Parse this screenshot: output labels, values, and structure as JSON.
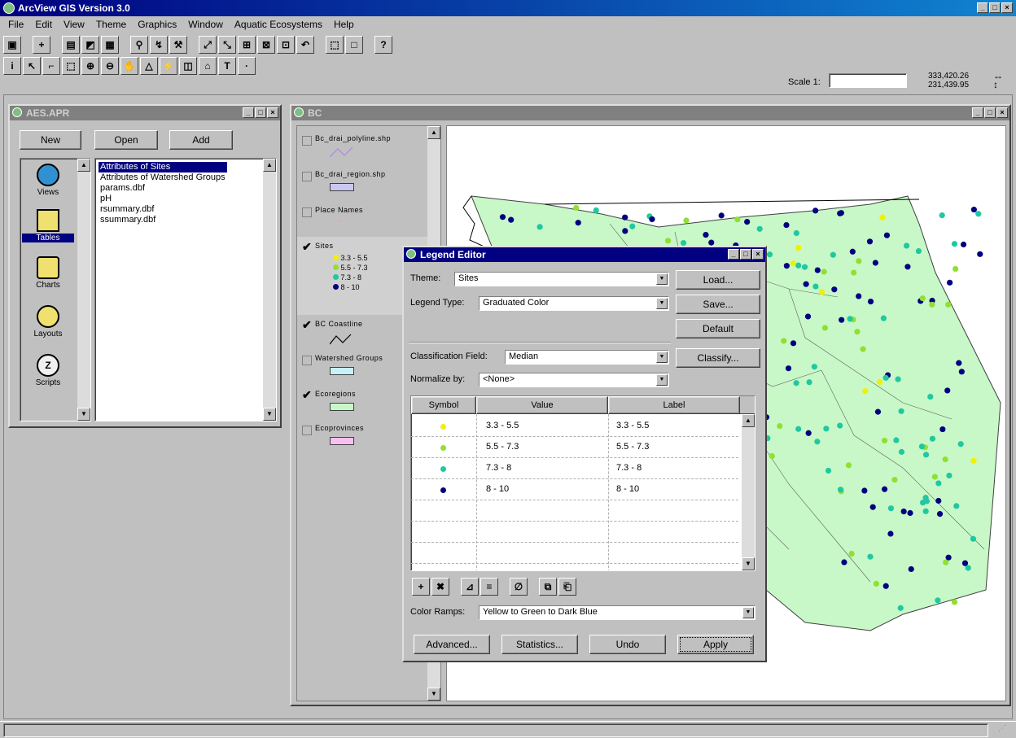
{
  "app": {
    "title": "ArcView GIS Version 3.0"
  },
  "menu": [
    "File",
    "Edit",
    "View",
    "Theme",
    "Graphics",
    "Window",
    "Aquatic Ecosystems",
    "Help"
  ],
  "toolbar": {
    "scale_label": "Scale 1:",
    "scale_value": "",
    "coord_x": "333,420.26",
    "coord_y": "231,439.95"
  },
  "project": {
    "title": "AES.APR",
    "new_label": "New",
    "open_label": "Open",
    "add_label": "Add",
    "doc_types": [
      "Views",
      "Tables",
      "Charts",
      "Layouts",
      "Scripts"
    ],
    "selected_type": "Tables",
    "items": [
      "Attributes of Sites",
      "Attributes of Watershed Groups",
      "params.dbf",
      "pH",
      "rsummary.dbf",
      "ssummary.dbf"
    ]
  },
  "view": {
    "title": "BC",
    "themes": [
      {
        "name": "Bc_drai_polyline.shp",
        "checked": false,
        "swatch": "line",
        "color": "#c0a0e0"
      },
      {
        "name": "Bc_drai_region.shp",
        "checked": false,
        "swatch": "fill",
        "color": "#c8c8f0"
      },
      {
        "name": "Place Names",
        "checked": false,
        "swatch": "point",
        "color": "#f0a0a0"
      },
      {
        "name": "Sites",
        "checked": true,
        "swatch": "classes"
      },
      {
        "name": "BC Coastline",
        "checked": true,
        "swatch": "line",
        "color": "#000000"
      },
      {
        "name": "Watershed Groups",
        "checked": false,
        "swatch": "fill",
        "color": "#c8f0f8"
      },
      {
        "name": "Ecoregions",
        "checked": true,
        "swatch": "fill",
        "color": "#c8f8c8"
      },
      {
        "name": "Ecoprovinces",
        "checked": false,
        "swatch": "fill",
        "color": "#f8c0f0"
      }
    ],
    "site_classes": [
      {
        "label": "3.3 - 5.5",
        "color": "#f0f000"
      },
      {
        "label": "5.5 - 7.3",
        "color": "#90e030"
      },
      {
        "label": "7.3 - 8",
        "color": "#20c8a0"
      },
      {
        "label": "8 - 10",
        "color": "#000080"
      }
    ]
  },
  "legend_editor": {
    "title": "Legend Editor",
    "theme_label": "Theme:",
    "theme_value": "Sites",
    "legend_type_label": "Legend Type:",
    "legend_type_value": "Graduated Color",
    "load_label": "Load...",
    "save_label": "Save...",
    "default_label": "Default",
    "classification_label": "Classification Field:",
    "classification_value": "Median",
    "classify_label": "Classify...",
    "normalize_label": "Normalize by:",
    "normalize_value": "<None>",
    "columns": [
      "Symbol",
      "Value",
      "Label"
    ],
    "rows": [
      {
        "value": "3.3 - 5.5",
        "label": "3.3 - 5.5",
        "color": "#f0f000"
      },
      {
        "value": "5.5 - 7.3",
        "label": "5.5 - 7.3",
        "color": "#90e030"
      },
      {
        "value": "7.3 - 8",
        "label": "7.3 - 8",
        "color": "#20c8a0"
      },
      {
        "value": "8 - 10",
        "label": "8 - 10",
        "color": "#000080"
      }
    ],
    "color_ramps_label": "Color Ramps:",
    "color_ramps_value": "Yellow to Green to Dark Blue",
    "advanced_label": "Advanced...",
    "statistics_label": "Statistics...",
    "undo_label": "Undo",
    "apply_label": "Apply"
  },
  "colors": {
    "map_fill": "#c8f8c8",
    "title_active": "#000080",
    "title_inactive": "#808080"
  }
}
